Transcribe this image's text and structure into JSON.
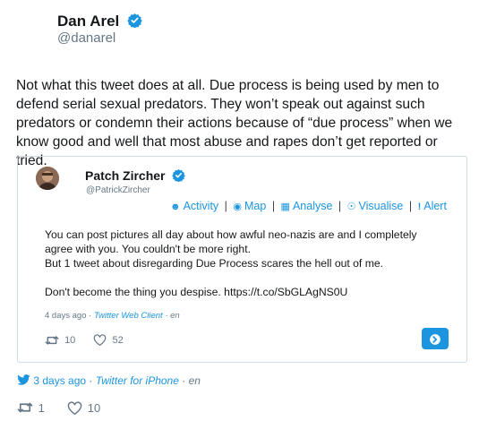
{
  "tweet": {
    "author_name": "Dan Arel",
    "author_handle": "@danarel",
    "text": "Not what this tweet does at all. Due process is being used by men to defend serial sexual predators. They won’t speak out against such predators or condemn their actions because of “due process” when we know good and well that most abuse and rapes don’t get reported or tried.",
    "time": "3 days ago",
    "client": "Twitter for iPhone",
    "lang": "en",
    "retweets": "1",
    "likes": "10"
  },
  "quote": {
    "author_name": "Patch Zircher",
    "author_handle": "@PatrickZircher",
    "tools": [
      "Activity",
      "Map",
      "Analyse",
      "Visualise",
      "Alert"
    ],
    "paragraph1": "You can post pictures all day about how awful neo-nazis are and I completely agree with you. You couldn't be more right.",
    "paragraph2": "But 1 tweet about disregarding Due Process scares the hell out of me.",
    "paragraph3": "Don't become the thing you despise. https://t.co/SbGLAgNS0U",
    "time": "4 days ago",
    "client": "Twitter Web Client",
    "lang": "en",
    "retweets": "10",
    "likes": "52"
  },
  "icons": {
    "verified": "verified-badge-icon",
    "activity": "person-icon",
    "map": "globe-icon",
    "analyse": "table-icon",
    "visualise": "eye-icon",
    "alert": "exclamation-icon",
    "retweet": "retweet-icon",
    "like": "heart-icon",
    "twitter": "twitter-bird-icon",
    "open": "arrow-right-circle-icon"
  },
  "colors": {
    "accent": "#1b95e0",
    "text": "#14171a",
    "muted": "#657786",
    "border": "#d3dbe2"
  }
}
